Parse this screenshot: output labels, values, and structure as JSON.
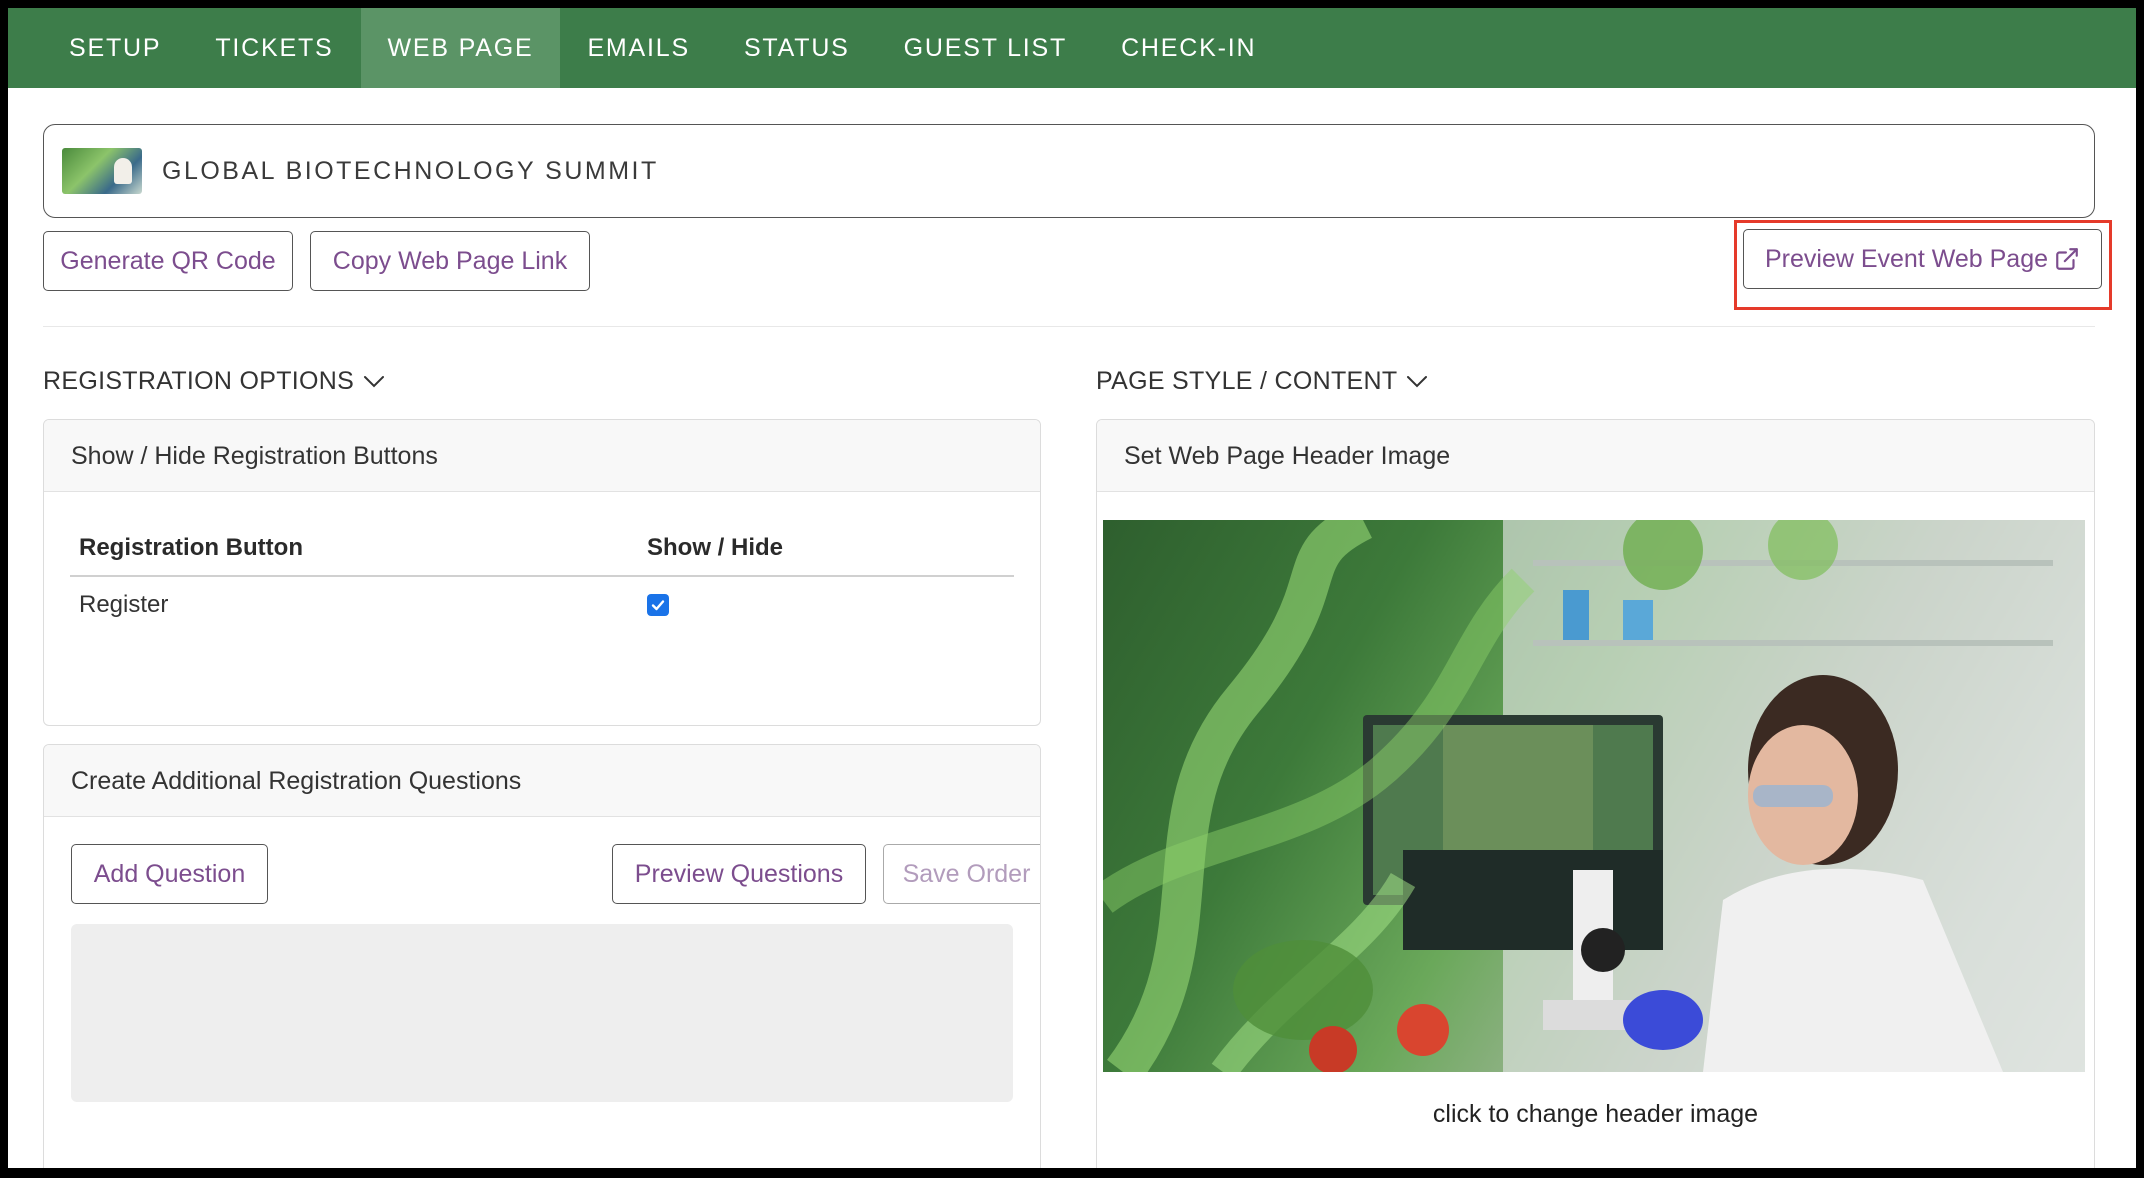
{
  "nav": {
    "tabs": [
      {
        "label": "SETUP"
      },
      {
        "label": "TICKETS"
      },
      {
        "label": "WEB PAGE",
        "active": true
      },
      {
        "label": "EMAILS"
      },
      {
        "label": "STATUS"
      },
      {
        "label": "GUEST LIST"
      },
      {
        "label": "CHECK-IN"
      }
    ]
  },
  "event": {
    "title": "GLOBAL BIOTECHNOLOGY SUMMIT"
  },
  "actions": {
    "qr_label": "Generate QR Code",
    "copy_label": "Copy Web Page Link",
    "preview_label": "Preview Event Web Page"
  },
  "registration": {
    "section_title": "REGISTRATION OPTIONS",
    "buttons_panel_title": "Show / Hide Registration Buttons",
    "table": {
      "col_button": "Registration Button",
      "col_show": "Show / Hide",
      "rows": [
        {
          "name": "Register",
          "shown": true
        }
      ]
    },
    "questions_panel_title": "Create Additional Registration Questions",
    "add_question_label": "Add Question",
    "preview_questions_label": "Preview Questions",
    "save_order_label": "Save Order"
  },
  "page_style": {
    "section_title": "PAGE STYLE / CONTENT",
    "header_panel_title": "Set Web Page Header Image",
    "caption": "click to change header image"
  },
  "colors": {
    "nav_bg": "#3d7d4a",
    "nav_active": "#5b9466",
    "accent_text": "#7c4d8e",
    "highlight": "#e53a2a"
  }
}
